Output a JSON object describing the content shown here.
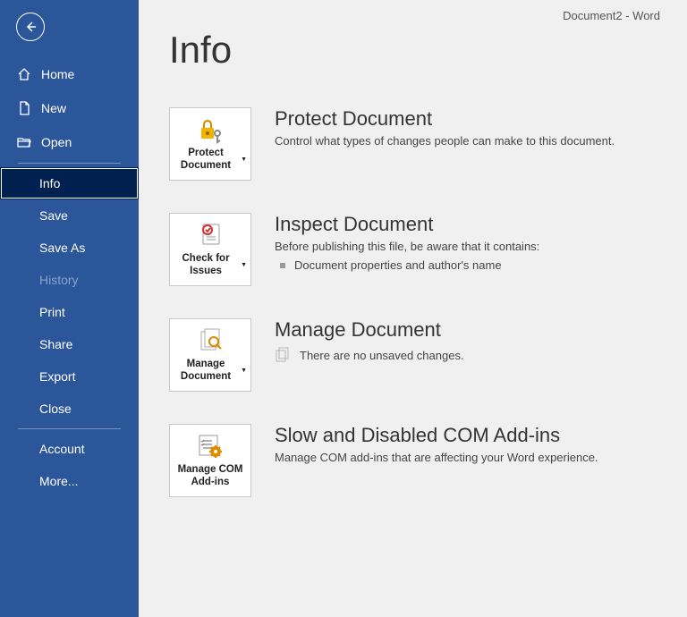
{
  "titlebar": {
    "doc_name": "Document2",
    "sep": "  -  ",
    "app_name": "Word"
  },
  "sidebar": {
    "home": "Home",
    "new": "New",
    "open": "Open",
    "info": "Info",
    "save": "Save",
    "save_as": "Save As",
    "history": "History",
    "print": "Print",
    "share": "Share",
    "export": "Export",
    "close": "Close",
    "account": "Account",
    "more": "More..."
  },
  "page": {
    "title": "Info"
  },
  "protect": {
    "tile_label": "Protect Document",
    "title": "Protect Document",
    "desc": "Control what types of changes people can make to this document."
  },
  "inspect": {
    "tile_label": "Check for Issues",
    "title": "Inspect Document",
    "desc": "Before publishing this file, be aware that it contains:",
    "item1": "Document properties and author's name"
  },
  "manage": {
    "tile_label": "Manage Document",
    "title": "Manage Document",
    "desc": "There are no unsaved changes."
  },
  "addins": {
    "tile_label": "Manage COM Add-ins",
    "title": "Slow and Disabled COM Add-ins",
    "desc": "Manage COM add-ins that are affecting your Word experience."
  }
}
